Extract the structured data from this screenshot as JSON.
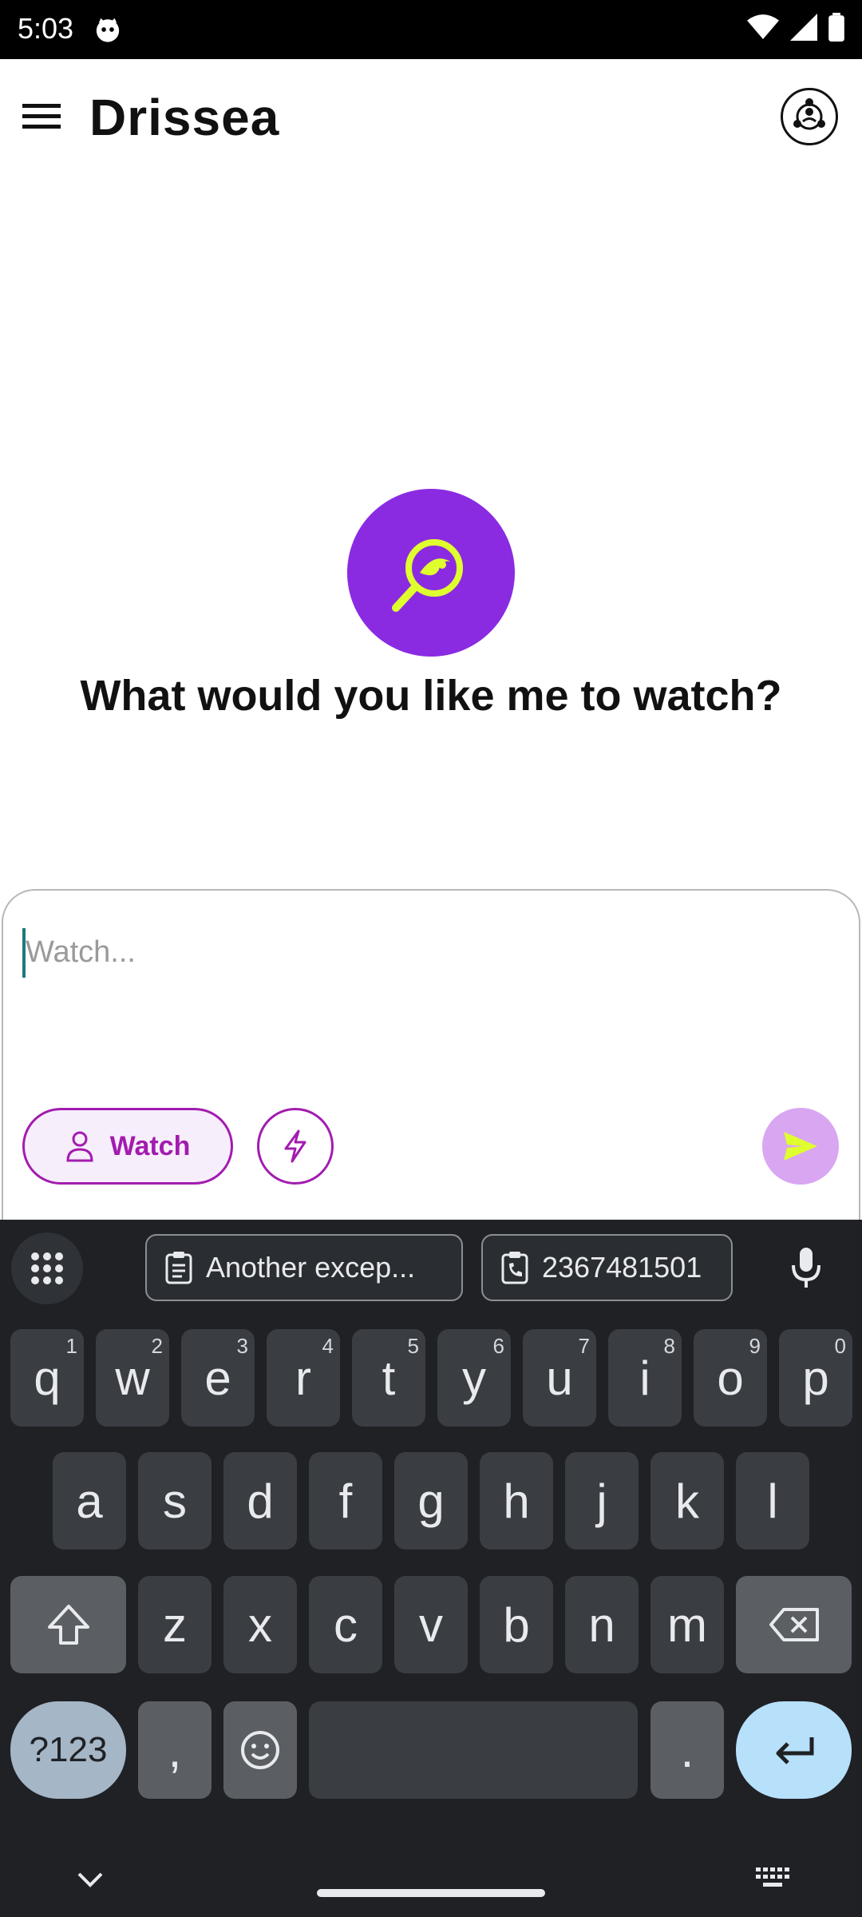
{
  "status_bar": {
    "time": "5:03"
  },
  "app_bar": {
    "title": "Drissea"
  },
  "hero": {
    "title": "What would you like me to watch?"
  },
  "composer": {
    "placeholder": "Watch...",
    "mode_chip_label": "Watch"
  },
  "keyboard": {
    "clipboard": [
      {
        "label": "Another excep..."
      },
      {
        "label": "2367481501"
      }
    ],
    "row1": [
      {
        "key": "q",
        "hint": "1"
      },
      {
        "key": "w",
        "hint": "2"
      },
      {
        "key": "e",
        "hint": "3"
      },
      {
        "key": "r",
        "hint": "4"
      },
      {
        "key": "t",
        "hint": "5"
      },
      {
        "key": "y",
        "hint": "6"
      },
      {
        "key": "u",
        "hint": "7"
      },
      {
        "key": "i",
        "hint": "8"
      },
      {
        "key": "o",
        "hint": "9"
      },
      {
        "key": "p",
        "hint": "0"
      }
    ],
    "row2": [
      "a",
      "s",
      "d",
      "f",
      "g",
      "h",
      "j",
      "k",
      "l"
    ],
    "row3": [
      "z",
      "x",
      "c",
      "v",
      "b",
      "n",
      "m"
    ],
    "symbols_label": "?123",
    "comma": ",",
    "period": "."
  },
  "colors": {
    "accent": "#8a2be2",
    "chip": "#a21caf",
    "icon_lime": "#dfff2e",
    "keyboard_bg": "#1f2125",
    "key_bg": "#3a3d42"
  }
}
